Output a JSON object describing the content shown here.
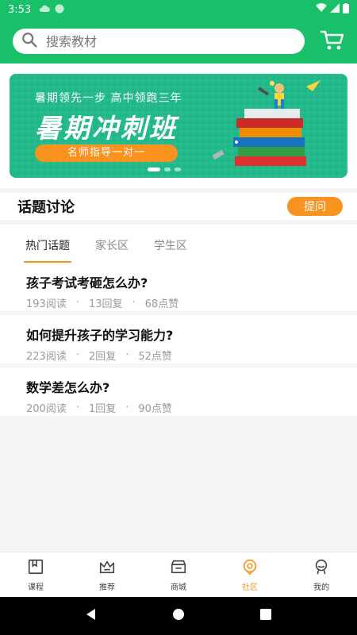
{
  "status_bar": {
    "time": "3:53"
  },
  "header": {
    "search_placeholder": "搜索教材"
  },
  "banner": {
    "subtitle": "暑期领先一步 高中领跑三年",
    "title": "暑期冲刺班",
    "pill": "名师指导一对一",
    "slides": 3,
    "active_slide": 1
  },
  "topics": {
    "title": "话题讨论",
    "ask_label": "提问",
    "tabs": [
      {
        "label": "热门话题",
        "active": true
      },
      {
        "label": "家长区",
        "active": false
      },
      {
        "label": "学生区",
        "active": false
      }
    ],
    "posts": [
      {
        "title": "孩子考试考砸怎么办?",
        "reads": "193阅读",
        "replies": "13回复",
        "likes": "68点赞"
      },
      {
        "title": "如何提升孩子的学习能力?",
        "reads": "223阅读",
        "replies": "2回复",
        "likes": "52点赞"
      },
      {
        "title": "数学差怎么办?",
        "reads": "200阅读",
        "replies": "1回复",
        "likes": "90点赞"
      }
    ],
    "separator": "·"
  },
  "bottom_nav": [
    {
      "label": "课程",
      "icon": "course-icon",
      "active": false
    },
    {
      "label": "推荐",
      "icon": "crown-icon",
      "active": false
    },
    {
      "label": "商城",
      "icon": "store-icon",
      "active": false
    },
    {
      "label": "社区",
      "icon": "community-icon",
      "active": true
    },
    {
      "label": "我的",
      "icon": "profile-icon",
      "active": false
    }
  ],
  "colors": {
    "brand_green": "#18c06a",
    "accent_orange": "#f7931e",
    "banner_green": "#20b889"
  }
}
